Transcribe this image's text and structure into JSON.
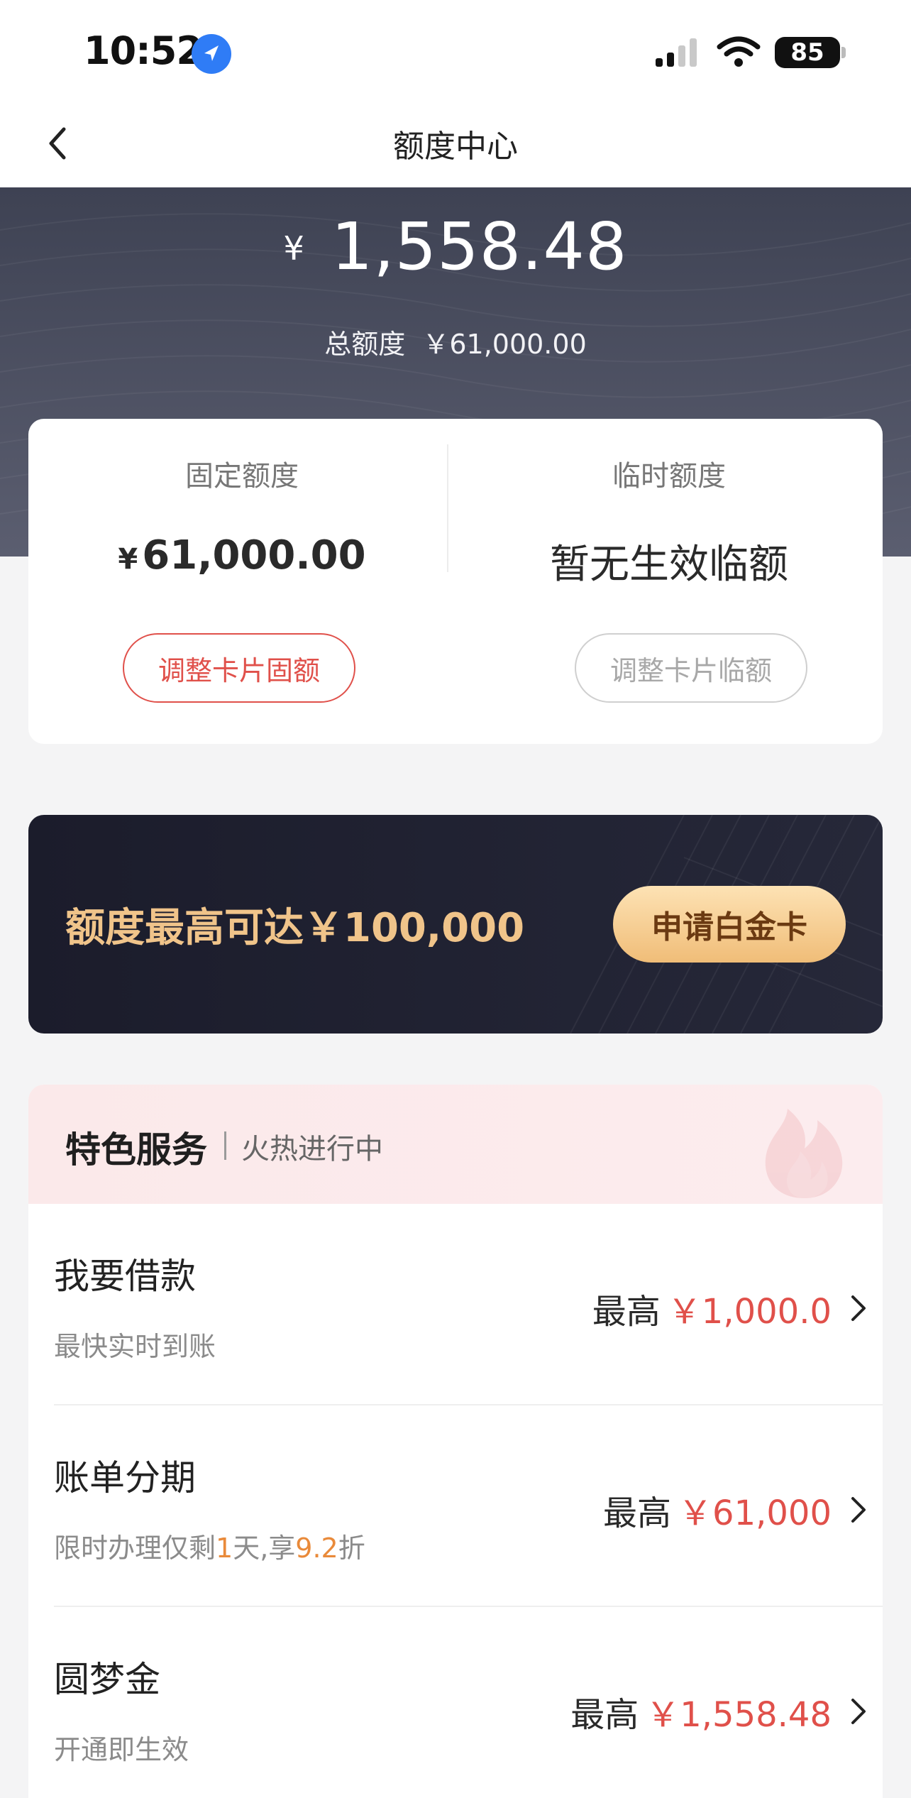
{
  "status_bar": {
    "time": "10:52",
    "battery": "85"
  },
  "nav": {
    "title": "额度中心"
  },
  "hero": {
    "currency": "¥",
    "available_amount": "1,558.48",
    "total_label": "总额度",
    "total_value": "￥61,000.00"
  },
  "limits": {
    "fixed": {
      "label": "固定额度",
      "currency": "¥",
      "value": "61,000.00",
      "button": "调整卡片固额"
    },
    "temporary": {
      "label": "临时额度",
      "value": "暂无生效临额",
      "button": "调整卡片临额"
    }
  },
  "platinum": {
    "text": "额度最高可达￥100,000",
    "button": "申请白金卡"
  },
  "services": {
    "title": "特色服务",
    "subtitle": "火热进行中",
    "items": [
      {
        "name": "我要借款",
        "desc": "最快实时到账",
        "prefix": "最高",
        "amount": "￥1,000.0"
      },
      {
        "name": "账单分期",
        "desc_a": "限时办理仅剩",
        "desc_days": "1",
        "desc_b": "天,享",
        "desc_discount": "9.2",
        "desc_c": "折",
        "prefix": "最高",
        "amount": "￥61,000"
      },
      {
        "name": "圆梦金",
        "desc": "开通即生效",
        "prefix": "最高",
        "amount": "￥1,558.48"
      }
    ]
  },
  "colors": {
    "accent_red": "#e0504a",
    "gold_text": "#f0c48a",
    "hero_bg": "#4a4d5e",
    "banner_bg": "#1f2030"
  }
}
